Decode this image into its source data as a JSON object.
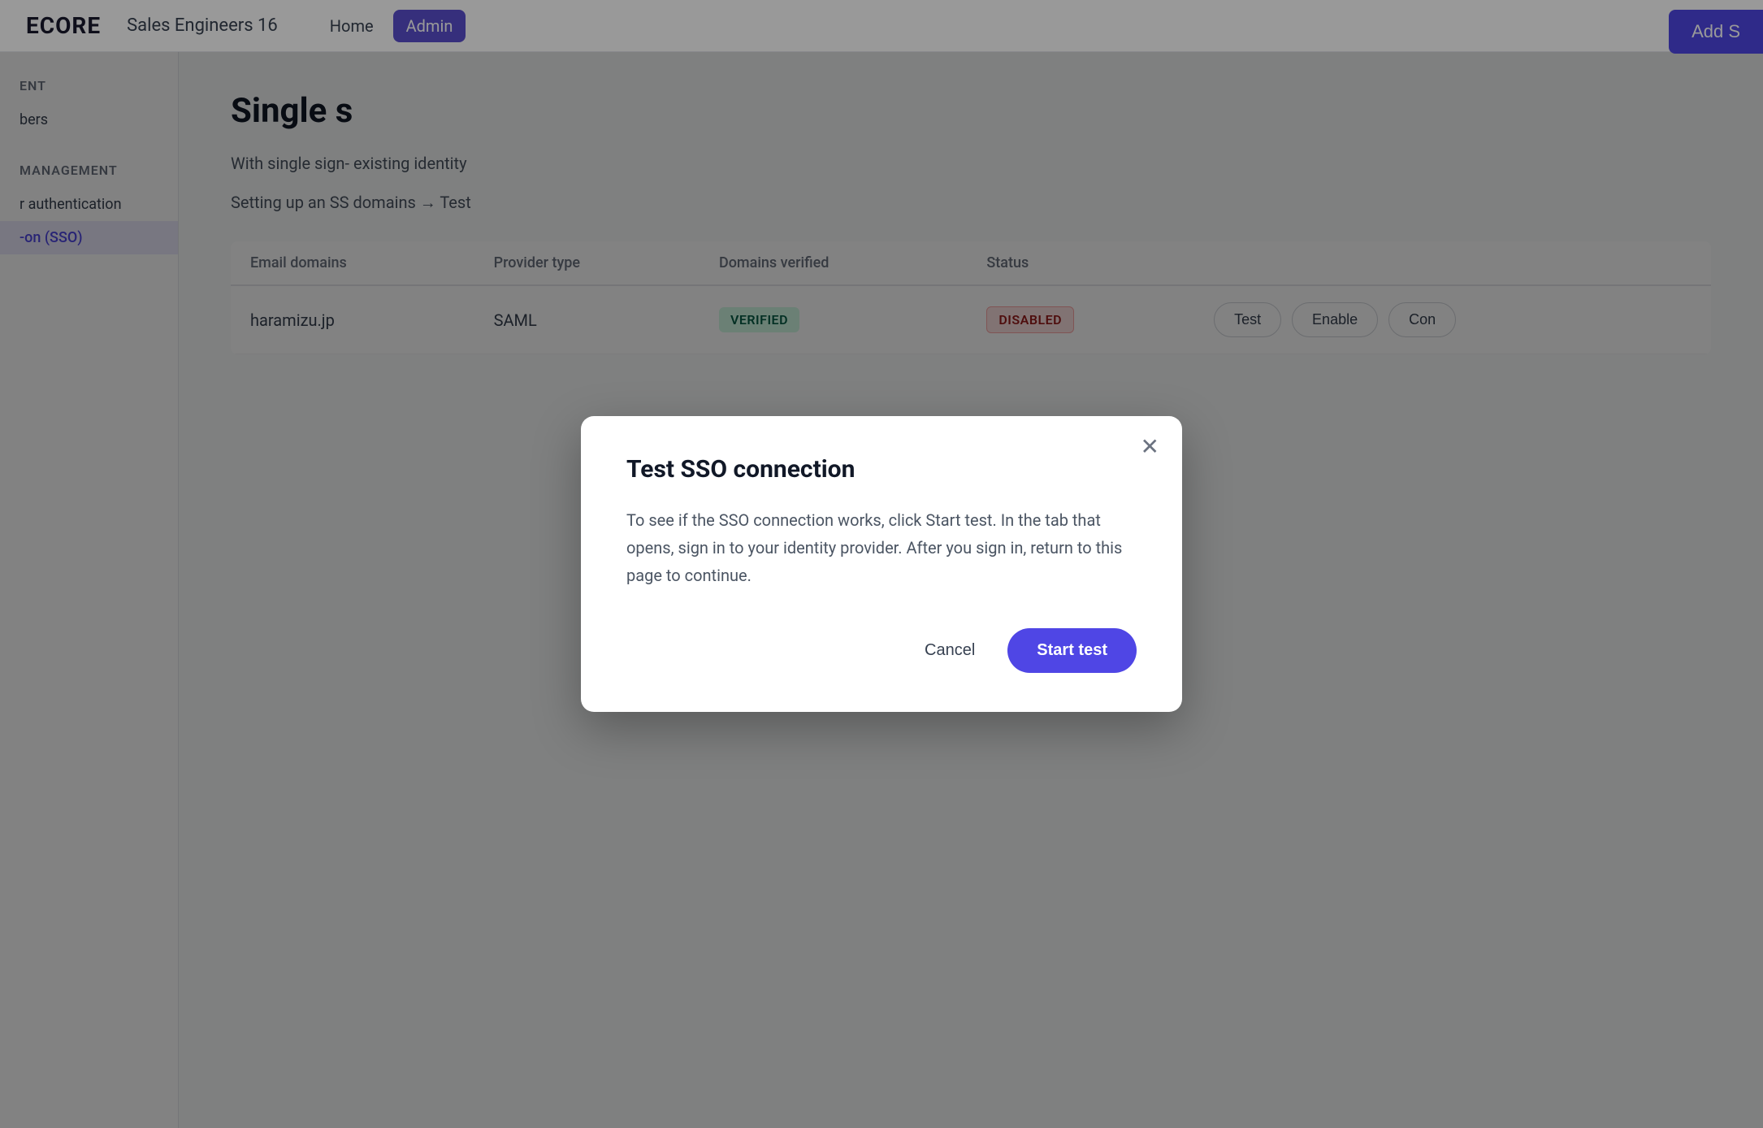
{
  "topbar": {
    "logo": "ECORE",
    "org_name": "Sales Engineers 16",
    "nav_home": "Home",
    "nav_admin": "Admin",
    "add_btn": "Add S"
  },
  "sidebar": {
    "section1": "ENT",
    "item_members": "bers",
    "section2": "MANAGEMENT",
    "item_authentication": "r authentication",
    "item_sso": "-on (SSO)"
  },
  "content": {
    "page_title": "Single s",
    "description1": "With single sign- existing identity",
    "description2": "Setting up an SS domains → Test",
    "table": {
      "col_email": "Email domains",
      "col_provider": "Provider type",
      "col_domains": "Domains verified",
      "col_status": "Status",
      "rows": [
        {
          "email": "haramizu.jp",
          "provider": "SAML",
          "domains": "VERIFIED",
          "status": "DISABLED",
          "actions": [
            "Test",
            "Enable",
            "Con"
          ]
        }
      ]
    }
  },
  "modal": {
    "title": "Test SSO connection",
    "body": "To see if the SSO connection works, click Start test. In the tab that opens, sign in to your identity provider. After you sign in, return to this page to continue.",
    "cancel_label": "Cancel",
    "start_test_label": "Start test"
  },
  "colors": {
    "primary": "#4f46e5",
    "verified_bg": "#d1fae5",
    "verified_text": "#065f46",
    "disabled_bg": "#fee2e2",
    "disabled_text": "#991b1b"
  }
}
